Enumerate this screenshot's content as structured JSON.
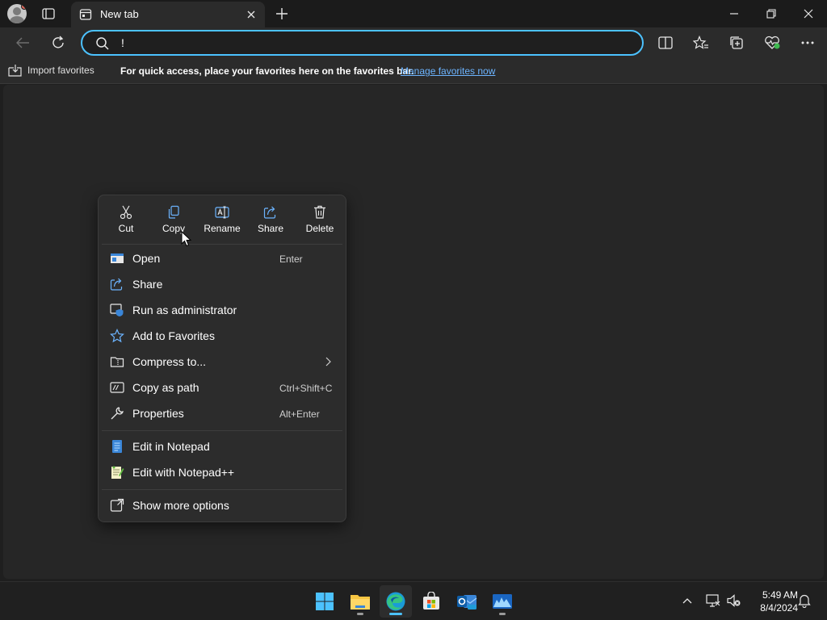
{
  "browser": {
    "tab_title": "New tab",
    "address_value": "!",
    "favorites_bar": {
      "import_label": "Import favorites",
      "message": "For quick access, place your favorites here on the favorites bar.",
      "manage_link": "Manage favorites now"
    }
  },
  "context_menu": {
    "quick_actions": [
      {
        "label": "Cut",
        "icon": "cut-icon"
      },
      {
        "label": "Copy",
        "icon": "copy-icon"
      },
      {
        "label": "Rename",
        "icon": "rename-icon"
      },
      {
        "label": "Share",
        "icon": "share-icon"
      },
      {
        "label": "Delete",
        "icon": "delete-icon"
      }
    ],
    "items": [
      {
        "label": "Open",
        "shortcut": "Enter",
        "icon": "open-icon"
      },
      {
        "label": "Share",
        "shortcut": "",
        "icon": "share-icon"
      },
      {
        "label": "Run as administrator",
        "shortcut": "",
        "icon": "shield-icon"
      },
      {
        "label": "Add to Favorites",
        "shortcut": "",
        "icon": "star-icon"
      },
      {
        "label": "Compress to...",
        "shortcut": "",
        "icon": "compress-icon",
        "submenu": true
      },
      {
        "label": "Copy as path",
        "shortcut": "Ctrl+Shift+C",
        "icon": "path-icon"
      },
      {
        "label": "Properties",
        "shortcut": "Alt+Enter",
        "icon": "wrench-icon"
      },
      {
        "label": "Edit in Notepad",
        "shortcut": "",
        "icon": "notepad-icon"
      },
      {
        "label": "Edit with Notepad++",
        "shortcut": "",
        "icon": "notepadpp-icon"
      },
      {
        "label": "Show more options",
        "shortcut": "",
        "icon": "more-options-icon"
      }
    ]
  },
  "taskbar": {
    "apps": [
      "windows-start-icon",
      "file-explorer-icon",
      "edge-icon",
      "store-icon",
      "outlook-icon",
      "monitor-app-icon"
    ],
    "clock": {
      "time": "5:49 AM",
      "date": "8/4/2024"
    }
  },
  "colors": {
    "accent": "#4cc2ff",
    "link": "#6cb4ff",
    "menu_bg": "#2c2c2c"
  }
}
